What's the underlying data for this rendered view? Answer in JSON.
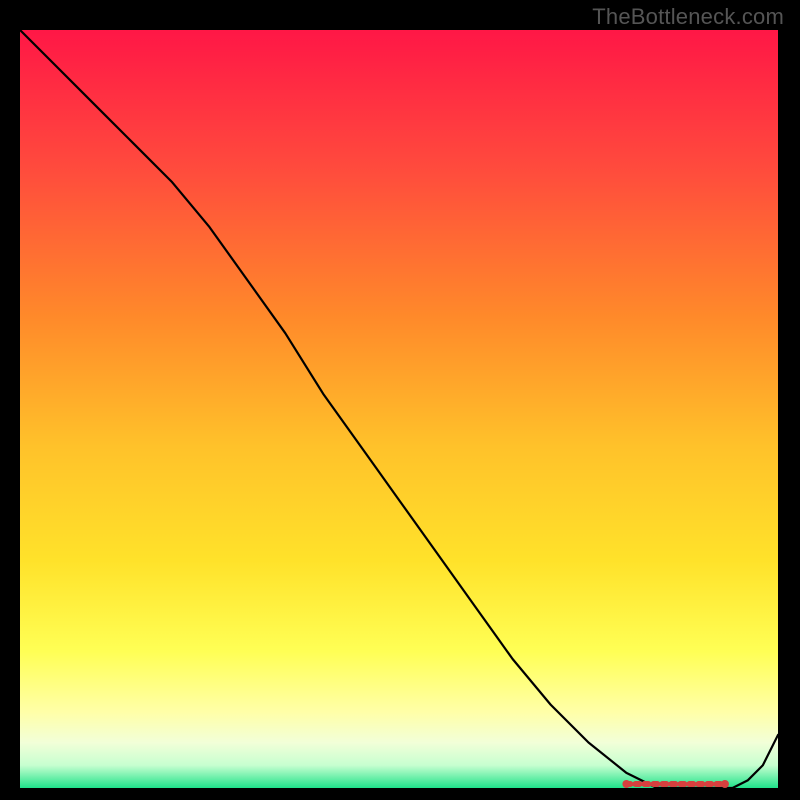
{
  "watermark": "TheBottleneck.com",
  "chart_data": {
    "type": "line",
    "title": "",
    "xlabel": "",
    "ylabel": "",
    "xlim": [
      0,
      100
    ],
    "ylim": [
      0,
      100
    ],
    "grid": false,
    "legend": false,
    "background_gradient": {
      "top": "#ff1746",
      "mid_upper": "#ff8a2a",
      "mid": "#ffd72a",
      "mid_lower": "#ffff7a",
      "near_bottom": "#f4ffcf",
      "bottom": "#1fe28a"
    },
    "series": [
      {
        "name": "curve",
        "stroke": "#000000",
        "x": [
          0,
          5,
          10,
          15,
          20,
          25,
          30,
          35,
          40,
          45,
          50,
          55,
          60,
          65,
          70,
          75,
          80,
          82,
          84,
          86,
          88,
          90,
          92,
          94,
          96,
          98,
          100
        ],
        "y": [
          100,
          95,
          90,
          85,
          80,
          74,
          67,
          60,
          52,
          45,
          38,
          31,
          24,
          17,
          11,
          6,
          2,
          1,
          0,
          0,
          0,
          0,
          0,
          0,
          1,
          3,
          7
        ]
      },
      {
        "name": "min-band-markers",
        "stroke": "#d6403f",
        "style": "dashed-band",
        "x_span": [
          80,
          93
        ],
        "y": 0
      }
    ],
    "annotations": []
  }
}
